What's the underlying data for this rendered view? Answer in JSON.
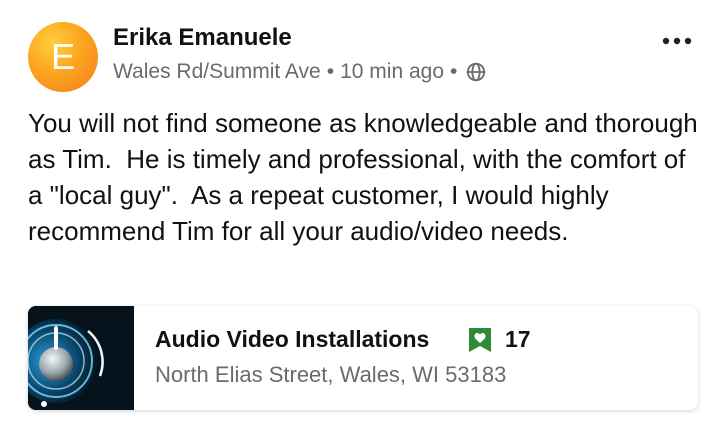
{
  "post": {
    "author": {
      "name": "Erika Emanuele",
      "initial": "E"
    },
    "neighborhood": "Wales Rd/Summit Ave",
    "separator": "•",
    "time": "10 min ago",
    "text": "You will not find someone as knowledgeable and thorough as Tim.  He is timely and professional, with the comfort of a \"local guy\".  As a repeat customer, I would highly recommend Tim for all your audio/video needs."
  },
  "business": {
    "name": "Audio Video Installations",
    "recommend_count": "17",
    "address": "North Elias Street, Wales, WI 53183"
  },
  "colors": {
    "accent_green": "#2e8b35",
    "avatar_orange": "#f7941e",
    "meta_gray": "#6b6b6b"
  },
  "icons": {
    "visibility": "globe-icon",
    "menu": "more-options-icon",
    "badge": "heart-badge-icon"
  }
}
